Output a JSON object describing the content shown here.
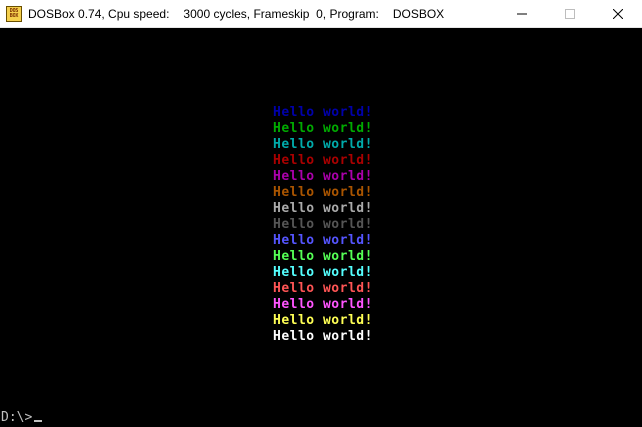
{
  "window": {
    "app_icon": "dosbox-icon",
    "app_icon_text": [
      "DOS",
      "BOX"
    ],
    "title_segments": [
      "DOSBox 0.74, Cpu speed:",
      "3000 cycles, Frameskip  0, Program:",
      "DOSBOX"
    ],
    "controls": [
      "minimize-icon",
      "maximize-icon",
      "close-icon"
    ]
  },
  "screen": {
    "lines": [
      {
        "text": "Hello world!",
        "color": "#0000aa"
      },
      {
        "text": "Hello world!",
        "color": "#00aa00"
      },
      {
        "text": "Hello world!",
        "color": "#00aaaa"
      },
      {
        "text": "Hello world!",
        "color": "#aa0000"
      },
      {
        "text": "Hello world!",
        "color": "#aa00aa"
      },
      {
        "text": "Hello world!",
        "color": "#aa5500"
      },
      {
        "text": "Hello world!",
        "color": "#aaaaaa"
      },
      {
        "text": "Hello world!",
        "color": "#555555"
      },
      {
        "text": "Hello world!",
        "color": "#5555ff"
      },
      {
        "text": "Hello world!",
        "color": "#55ff55"
      },
      {
        "text": "Hello world!",
        "color": "#55ffff"
      },
      {
        "text": "Hello world!",
        "color": "#ff5555"
      },
      {
        "text": "Hello world!",
        "color": "#ff55ff"
      },
      {
        "text": "Hello world!",
        "color": "#ffff55"
      },
      {
        "text": "Hello world!",
        "color": "#ffffff"
      }
    ],
    "prompt": "D:\\>"
  }
}
